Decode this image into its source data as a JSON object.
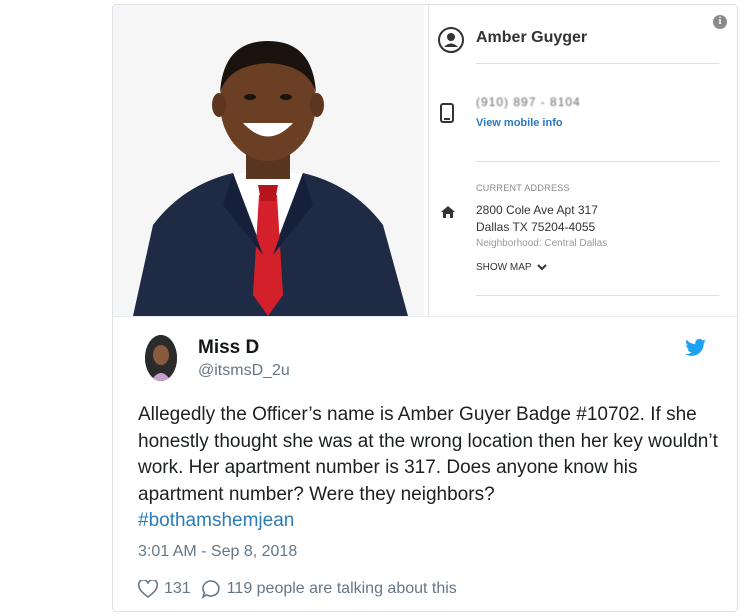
{
  "profile_card": {
    "person_name": "Amber Guyger",
    "phone": "(910) 897 - 8104",
    "mobile_link": "View mobile info",
    "address_label": "CURRENT ADDRESS",
    "address_line1": "2800 Cole Ave Apt 317",
    "address_line2": "Dallas TX 75204-4055",
    "neighborhood": "Neighborhood: Central Dallas",
    "show_map": "SHOW MAP",
    "info_icon": "i"
  },
  "tweet": {
    "display_name": "Miss D",
    "handle": "@itsmsD_2u",
    "body": "Allegedly the Officer’s name is Amber Guyer Badge  #10702. If she honestly thought she was at the wrong location then her key wouldn’t work. Her apartment number is 317. Does anyone know his apartment number?  Were they neighbors?",
    "hashtag": "#bothamshemjean",
    "timestamp": "3:01 AM - Sep 8, 2018",
    "likes": "131",
    "talking": "119 people are talking about this"
  },
  "colors": {
    "twitter_blue": "#1da1f2",
    "link_blue": "#2b7bb9",
    "muted": "#657786"
  },
  "icons": [
    "person-circle-icon",
    "phone-icon",
    "home-icon",
    "chevron-down-icon",
    "info-icon",
    "twitter-bird-icon",
    "heart-icon",
    "speech-bubble-icon"
  ]
}
